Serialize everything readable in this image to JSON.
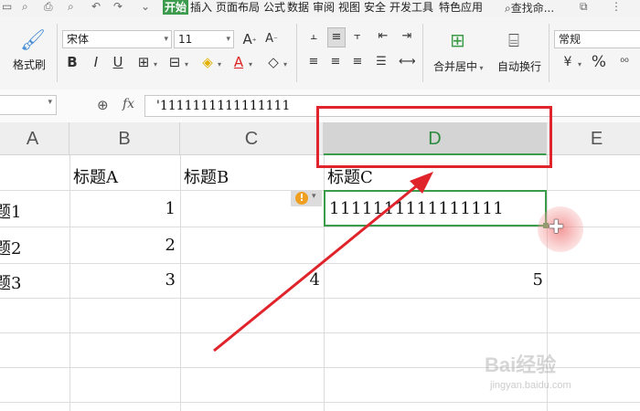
{
  "menu": {
    "tabs": [
      "开始",
      "插入",
      "页面布局",
      "公式",
      "数据",
      "审阅",
      "视图",
      "安全",
      "开发工具",
      "特色应用"
    ],
    "active_tab": "开始",
    "search_label": "查找命..."
  },
  "ribbon": {
    "format_painter_label": "格式刷",
    "font_name": "宋体",
    "font_size": "11",
    "merge_center_label": "合并居中",
    "wrap_text_label": "自动换行",
    "number_format": "常规",
    "currency_symbol": "¥",
    "percent_symbol": "%"
  },
  "formula_bar": {
    "fx_label": "fx",
    "value": "'1111111111111111"
  },
  "columns": [
    "A",
    "B",
    "C",
    "D",
    "E"
  ],
  "selected_column": "D",
  "rows": [
    {
      "a": "",
      "b": "标题A",
      "c": "标题B",
      "d": "标题C",
      "e": ""
    },
    {
      "a": "题1",
      "b": "1",
      "c": "",
      "d": "1111111111111111",
      "e": ""
    },
    {
      "a": "题2",
      "b": "2",
      "c": "",
      "d": "",
      "e": ""
    },
    {
      "a": "题3",
      "b": "3",
      "c": "4",
      "d": "5",
      "e": ""
    }
  ],
  "warning_icon": "!",
  "watermark": {
    "brand": "Bai经验",
    "url": "jingyan.baidu.com"
  },
  "colors": {
    "accent_green": "#3a9b48",
    "annotation_red": "#e0242c"
  }
}
